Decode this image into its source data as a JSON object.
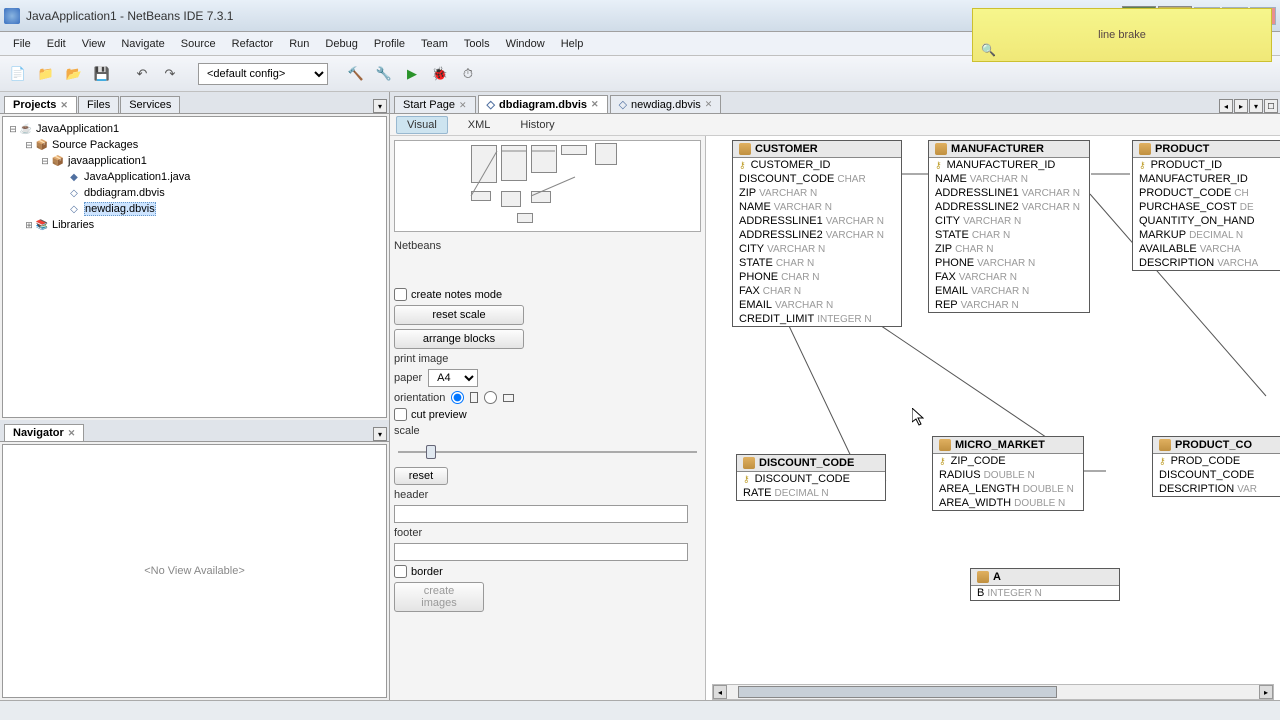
{
  "title": "JavaApplication1 - NetBeans IDE 7.3.1",
  "floating_note": "line brake",
  "menubar": [
    "File",
    "Edit",
    "View",
    "Navigate",
    "Source",
    "Refactor",
    "Run",
    "Debug",
    "Profile",
    "Team",
    "Tools",
    "Window",
    "Help"
  ],
  "toolbar": {
    "config_select": "<default config>"
  },
  "left": {
    "tabs": [
      "Projects",
      "Files",
      "Services"
    ],
    "tree": {
      "root": "JavaApplication1",
      "src_pkg": "Source Packages",
      "pkg": "javaapplication1",
      "files": [
        "JavaApplication1.java",
        "dbdiagram.dbvis",
        "newdiag.dbvis"
      ],
      "libs": "Libraries"
    },
    "navigator": {
      "title": "Navigator",
      "empty": "<No View Available>"
    }
  },
  "editor": {
    "tabs": [
      {
        "label": "Start Page"
      },
      {
        "label": "dbdiagram.dbvis",
        "active": true
      },
      {
        "label": "newdiag.dbvis"
      }
    ],
    "subtabs": [
      "Visual",
      "XML",
      "History"
    ]
  },
  "options": {
    "title": "Netbeans",
    "create_notes_mode": "create notes mode",
    "reset_scale": "reset scale",
    "arrange_blocks": "arrange blocks",
    "print_image": "print image",
    "paper_label": "paper",
    "paper_value": "A4",
    "orientation": "orientation",
    "cut_preview": "cut preview",
    "scale": "scale",
    "reset": "reset",
    "header": "header",
    "footer": "footer",
    "border": "border",
    "create_images": "create images"
  },
  "tables": {
    "customer": {
      "name": "CUSTOMER",
      "cols": [
        {
          "n": "CUSTOMER_ID",
          "t": "",
          "pk": true
        },
        {
          "n": "DISCOUNT_CODE",
          "t": "CHAR"
        },
        {
          "n": "ZIP",
          "t": "VARCHAR N"
        },
        {
          "n": "NAME",
          "t": "VARCHAR N"
        },
        {
          "n": "ADDRESSLINE1",
          "t": "VARCHAR N"
        },
        {
          "n": "ADDRESSLINE2",
          "t": "VARCHAR N"
        },
        {
          "n": "CITY",
          "t": "VARCHAR N"
        },
        {
          "n": "STATE",
          "t": "CHAR N"
        },
        {
          "n": "PHONE",
          "t": "CHAR N"
        },
        {
          "n": "FAX",
          "t": "CHAR N"
        },
        {
          "n": "EMAIL",
          "t": "VARCHAR N"
        },
        {
          "n": "CREDIT_LIMIT",
          "t": "INTEGER N"
        }
      ]
    },
    "manufacturer": {
      "name": "MANUFACTURER",
      "cols": [
        {
          "n": "MANUFACTURER_ID",
          "t": "",
          "pk": true
        },
        {
          "n": "NAME",
          "t": "VARCHAR N"
        },
        {
          "n": "ADDRESSLINE1",
          "t": "VARCHAR N"
        },
        {
          "n": "ADDRESSLINE2",
          "t": "VARCHAR N"
        },
        {
          "n": "CITY",
          "t": "VARCHAR N"
        },
        {
          "n": "STATE",
          "t": "CHAR N"
        },
        {
          "n": "ZIP",
          "t": "CHAR N"
        },
        {
          "n": "PHONE",
          "t": "VARCHAR N"
        },
        {
          "n": "FAX",
          "t": "VARCHAR N"
        },
        {
          "n": "EMAIL",
          "t": "VARCHAR N"
        },
        {
          "n": "REP",
          "t": "VARCHAR N"
        }
      ]
    },
    "product": {
      "name": "PRODUCT",
      "cols": [
        {
          "n": "PRODUCT_ID",
          "t": "",
          "pk": true
        },
        {
          "n": "MANUFACTURER_ID",
          "t": ""
        },
        {
          "n": "PRODUCT_CODE",
          "t": "CH"
        },
        {
          "n": "PURCHASE_COST",
          "t": "DE"
        },
        {
          "n": "QUANTITY_ON_HAND",
          "t": ""
        },
        {
          "n": "MARKUP",
          "t": "DECIMAL N"
        },
        {
          "n": "AVAILABLE",
          "t": "VARCHA"
        },
        {
          "n": "DESCRIPTION",
          "t": "VARCHA"
        }
      ]
    },
    "discount_code": {
      "name": "DISCOUNT_CODE",
      "cols": [
        {
          "n": "DISCOUNT_CODE",
          "t": "",
          "pk": true
        },
        {
          "n": "RATE",
          "t": "DECIMAL N"
        }
      ]
    },
    "micro_market": {
      "name": "MICRO_MARKET",
      "cols": [
        {
          "n": "ZIP_CODE",
          "t": "",
          "pk": true
        },
        {
          "n": "RADIUS",
          "t": "DOUBLE N"
        },
        {
          "n": "AREA_LENGTH",
          "t": "DOUBLE N"
        },
        {
          "n": "AREA_WIDTH",
          "t": "DOUBLE N"
        }
      ]
    },
    "product_co": {
      "name": "PRODUCT_CO",
      "cols": [
        {
          "n": "PROD_CODE",
          "t": "",
          "pk": true
        },
        {
          "n": "DISCOUNT_CODE",
          "t": ""
        },
        {
          "n": "DESCRIPTION",
          "t": "VAR"
        }
      ]
    },
    "a": {
      "name": "A",
      "cols": [
        {
          "n": "B",
          "t": "INTEGER N"
        }
      ]
    }
  },
  "scrollbar": {
    "thumb_left_pct": 2,
    "thumb_width_pct": 60
  }
}
